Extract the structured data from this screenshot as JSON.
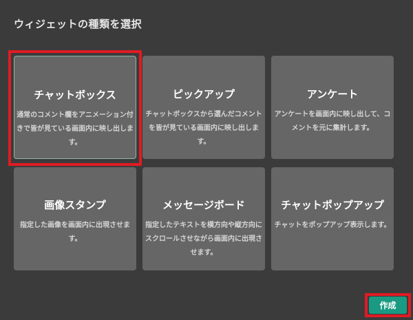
{
  "dialog": {
    "title": "ウィジェットの種類を選択",
    "create_label": "作成"
  },
  "widgets": [
    {
      "title": "チャットボックス",
      "description": "通常のコメント欄をアニメーション付きで皆が見ている画面内に映し出します。",
      "selected": true
    },
    {
      "title": "ピックアップ",
      "description": "チャットボックスから選んだコメントを皆が見ている画面内に映し出します。",
      "selected": false
    },
    {
      "title": "アンケート",
      "description": "アンケートを画面内に映し出して、コメントを元に集計します。",
      "selected": false
    },
    {
      "title": "画像スタンプ",
      "description": "指定した画像を画面内に出現させます。",
      "selected": false
    },
    {
      "title": "メッセージボード",
      "description": "指定したテキストを横方向や縦方向にスクロールさせながら画面内に出現させます。",
      "selected": false
    },
    {
      "title": "チャットポップアップ",
      "description": "チャットをポップアップ表示します。",
      "selected": false
    }
  ],
  "colors": {
    "background": "#3b3b3b",
    "card": "#666666",
    "selected_border": "#8fb9a8",
    "highlight": "#e01b24",
    "button": "#1a9a82"
  }
}
